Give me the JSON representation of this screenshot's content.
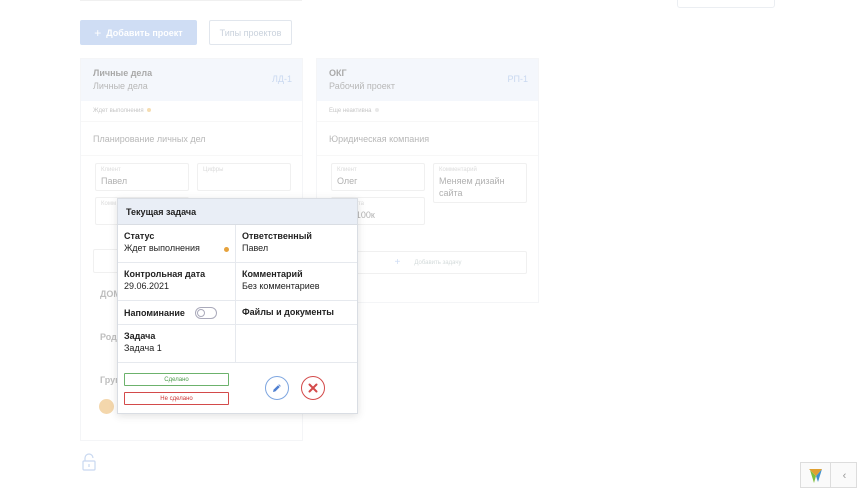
{
  "toolbar": {
    "add_project_label": "Добавить проект",
    "add_project_icon": "+",
    "project_types_label": "Типы проектов"
  },
  "projects": [
    {
      "name": "Личные дела",
      "type": "Личные дела",
      "code": "ЛД-1",
      "status": "Ждет выполнения",
      "description": "Планирование личных дел",
      "fields": [
        {
          "label": "Клиент",
          "value": "Павел"
        },
        {
          "label": "Цифры",
          "value": ""
        },
        {
          "label": "Комм",
          "value": ""
        }
      ],
      "sections": [
        "ДОМ",
        "Род",
        "Груп"
      ]
    },
    {
      "name": "ОКГ",
      "type": "Рабочий проект",
      "code": "РП-1",
      "status": "Еще неактивна",
      "description": "Юридическая компания",
      "fields": [
        {
          "label": "Клиент",
          "value": "Олег"
        },
        {
          "label": "Комментарий",
          "value": "Меняем дизайн сайта"
        },
        {
          "label": "...проекта",
          "value": "...ет 100к"
        }
      ],
      "add_task_label": "Добавить задачу"
    }
  ],
  "popup": {
    "title": "Текущая задача",
    "status_title": "Статус",
    "status_value": "Ждет выполнения",
    "responsible_title": "Ответственный",
    "responsible_value": "Павел",
    "deadline_title": "Контрольная дата",
    "deadline_value": "29.06.2021",
    "comment_title": "Комментарий",
    "comment_value": "Без комментариев",
    "reminder_title": "Напоминание",
    "reminder_on": false,
    "files_title": "Файлы и документы",
    "task_title": "Задача",
    "task_value": "Задача 1",
    "done_label": "Сделано",
    "not_done_label": "Не сделано"
  },
  "widget": {
    "chevron": "‹"
  },
  "colors": {
    "accent": "#8fb0e6",
    "status_waiting": "#e6a23c",
    "done": "#4a9a4a",
    "not_done": "#d34a4a"
  }
}
